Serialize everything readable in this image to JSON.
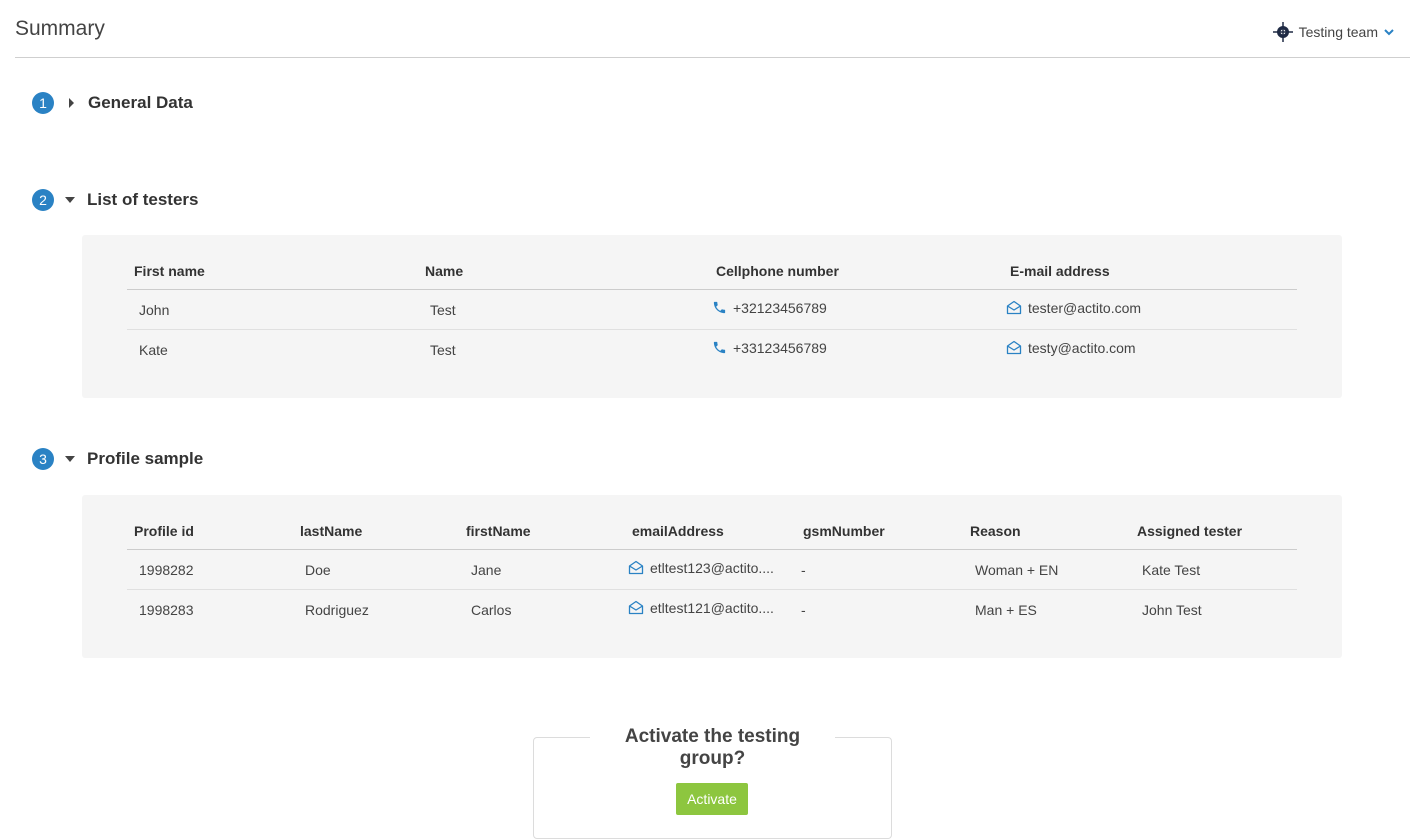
{
  "header": {
    "title": "Summary",
    "team_label": "Testing team"
  },
  "steps": [
    {
      "number": "1",
      "title": "General Data",
      "expanded": false
    },
    {
      "number": "2",
      "title": "List of testers",
      "expanded": true
    },
    {
      "number": "3",
      "title": "Profile sample",
      "expanded": true
    }
  ],
  "testers": {
    "columns": [
      "First name",
      "Name",
      "Cellphone number",
      "E-mail address"
    ],
    "rows": [
      {
        "first_name": "John",
        "name": "Test",
        "phone": "+32123456789",
        "email": "tester@actito.com"
      },
      {
        "first_name": "Kate",
        "name": "Test",
        "phone": "+33123456789",
        "email": "testy@actito.com"
      }
    ]
  },
  "profiles": {
    "columns": [
      "Profile id",
      "lastName",
      "firstName",
      "emailAddress",
      "gsmNumber",
      "Reason",
      "Assigned tester"
    ],
    "rows": [
      {
        "id": "1998282",
        "last": "Doe",
        "first": "Jane",
        "email": "etltest123@actito....",
        "gsm": "-",
        "reason": "Woman + EN",
        "tester": "Kate Test"
      },
      {
        "id": "1998283",
        "last": "Rodriguez",
        "first": "Carlos",
        "email": "etltest121@actito....",
        "gsm": "-",
        "reason": "Man + ES",
        "tester": "John Test"
      }
    ]
  },
  "activate": {
    "question": "Activate the testing group?",
    "button_label": "Activate"
  },
  "colors": {
    "accent": "#2a82c4",
    "button": "#8dc63f",
    "panel": "#f5f5f5"
  },
  "icons": {
    "team": "crosshair-icon",
    "team_dropdown": "chevron-down-icon",
    "phone": "phone-icon",
    "email": "envelope-icon"
  }
}
